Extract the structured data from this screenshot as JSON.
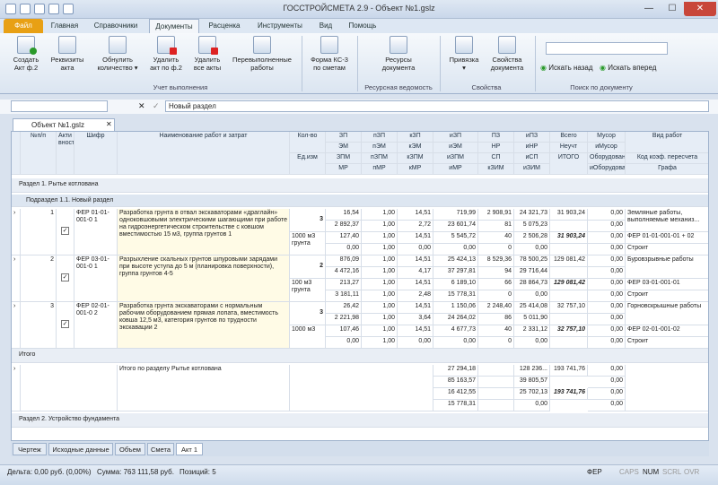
{
  "window": {
    "title": "ГОССТРОЙСМЕТА 2.9 - Объект №1.gslz",
    "minimize": "—",
    "maximize": "☐",
    "close": "✕"
  },
  "menu": {
    "file": "Файл",
    "tabs": [
      "Главная",
      "Справочники",
      "Документы",
      "Расценка",
      "Инструменты",
      "Вид",
      "Помощь"
    ]
  },
  "ribbon": {
    "buttons": [
      {
        "label": "Создать\nАкт ф.2",
        "icon": "new-act-icon"
      },
      {
        "label": "Реквизиты\nакта",
        "icon": "act-props-icon"
      },
      {
        "label": "Обнулить\nколичество ▾",
        "icon": "reset-qty-icon"
      },
      {
        "label": "Удалить\nакт по ф.2",
        "icon": "delete-act-icon"
      },
      {
        "label": "Удалить\nвсе акты",
        "icon": "delete-all-icon"
      },
      {
        "label": "Перевыполненные\nработы",
        "icon": "overdone-icon"
      },
      {
        "label": "Форма КС-3\nпо сметам",
        "icon": "ks3-icon"
      },
      {
        "label": "Ресурсы\nдокумента",
        "icon": "resources-icon"
      },
      {
        "label": "Привязка\n▾",
        "icon": "binding-icon"
      },
      {
        "label": "Свойства\nдокумента",
        "icon": "doc-props-icon"
      }
    ],
    "groups": [
      "Учет выполнения",
      "Ресурсная ведомость",
      "Свойства",
      "Поиск по документу"
    ],
    "search_back": "Искать назад",
    "search_fwd": "Искать вперед"
  },
  "formula": {
    "value": "Новый раздел",
    "cancel": "✕",
    "ok": "✓"
  },
  "doc_tab": "Объект №1.gslz",
  "header": {
    "num": "№п/п",
    "active": "Акти вность",
    "code": "Шифр",
    "name": "Наименование работ и затрат",
    "qty": "Кол-во",
    "unit": "Ед.изм",
    "cols": [
      [
        "ЗП",
        "ЭМ",
        "ЗПМ",
        "МР"
      ],
      [
        "пЗП",
        "пЭМ",
        "пЗПМ",
        "пМР"
      ],
      [
        "кЗП",
        "кЭМ",
        "кЗПМ",
        "кМР"
      ],
      [
        "иЗП",
        "иЭМ",
        "иЗПМ",
        "иМР"
      ],
      [
        "ПЗ",
        "НР",
        "СП",
        "кЗИМ"
      ],
      [
        "иПЗ",
        "иНР",
        "иСП",
        "иЗИМ"
      ]
    ],
    "total1": "Всего",
    "total2": "Неучт",
    "itogo": "ИТОГО",
    "trash": [
      "Мусор",
      "иМусор",
      "Оборудование",
      "иОборудование"
    ],
    "work": [
      "Вид работ",
      "Код коэф. пересчета",
      "Графа"
    ]
  },
  "section1": "Раздел 1. Рытье котлована",
  "subsection": "Подраздел 1.1. Новый раздел",
  "rows": [
    {
      "num": "1",
      "code": "ФЕР 01-01-001-0 1",
      "name": "Разработка грунта в отвал экскаваторами «драглайн» одноковшовыми электрическими шагающими при работе на гидроэнергетическом строительстве с ковшом вместимостью 15 м3, группа грунтов 1",
      "qty": "3",
      "unit": "1000 м3 грунта",
      "lines": [
        [
          "16,54",
          "1,00",
          "14,51",
          "719,99",
          "2 908,91",
          "24 321,73"
        ],
        [
          "2 892,37",
          "1,00",
          "2,72",
          "23 601,74",
          "81",
          "5 075,23"
        ],
        [
          "127,40",
          "1,00",
          "14,51",
          "5 545,72",
          "40",
          "2 506,28"
        ],
        [
          "0,00",
          "1,00",
          "0,00",
          "0,00",
          "0",
          "0,00"
        ]
      ],
      "total": "31 903,24",
      "itogo": "31 903,24",
      "trash": [
        "0,00",
        "0,00",
        "0,00",
        "0,00"
      ],
      "work": [
        "Земляные работы, выполняемые механиз...",
        "ФЕР 01-01-001-01 + 02",
        "Строит"
      ]
    },
    {
      "num": "2",
      "code": "ФЕР 03-01-001-0 1",
      "name": "Разрыхление скальных грунтов шпуровыми зарядами при высоте уступа до 5 м (планировка поверхности), группа грунтов 4-5",
      "qty": "2",
      "unit": "100 м3 грунта",
      "lines": [
        [
          "876,09",
          "1,00",
          "14,51",
          "25 424,13",
          "8 529,36",
          "78 500,25"
        ],
        [
          "4 472,16",
          "1,00",
          "4,17",
          "37 297,81",
          "94",
          "29 716,44"
        ],
        [
          "213,27",
          "1,00",
          "14,51",
          "6 189,10",
          "66",
          "28 864,73"
        ],
        [
          "3 181,11",
          "1,00",
          "2,48",
          "15 778,31",
          "0",
          "0,00"
        ]
      ],
      "total": "129 081,42",
      "itogo": "129 081,42",
      "trash": [
        "0,00",
        "0,00",
        "0,00",
        "0,00"
      ],
      "work": [
        "Буровзрывные работы",
        "ФЕР 03-01-001-01",
        "Строит"
      ]
    },
    {
      "num": "3",
      "code": "ФЕР 02-01-001-0 2",
      "name": "Разработка грунта экскаваторами с нормальным рабочим оборудованием прямая лопата, вместимость ковша 12,5 м3, категория грунтов по трудности экскавации 2",
      "qty": "3",
      "unit": "1000 м3",
      "lines": [
        [
          "26,42",
          "1,00",
          "14,51",
          "1 150,06",
          "2 248,40",
          "25 414,08"
        ],
        [
          "2 221,98",
          "1,00",
          "3,64",
          "24 264,02",
          "86",
          "5 011,90"
        ],
        [
          "107,46",
          "1,00",
          "14,51",
          "4 677,73",
          "40",
          "2 331,12"
        ],
        [
          "0,00",
          "1,00",
          "0,00",
          "0,00",
          "0",
          "0,00"
        ]
      ],
      "total": "32 757,10",
      "itogo": "32 757,10",
      "trash": [
        "0,00",
        "0,00",
        "0,00",
        "0,00"
      ],
      "work": [
        "Горновскрышные работы",
        "ФЕР 02-01-001-02",
        "Строит"
      ]
    }
  ],
  "itogo_label": "Итого",
  "itogo_row": {
    "name": "Итого по разделу Рытье котлована",
    "lines": [
      [
        "27 294,18",
        "128 236..."
      ],
      [
        "85 163,57",
        "39 805,57"
      ],
      [
        "16 412,55",
        "25 702,13"
      ],
      [
        "15 778,31",
        "0,00"
      ]
    ],
    "total": "193 741,76",
    "itogo": "193 741,76",
    "trash": [
      "0,00",
      "0,00",
      "0,00",
      "0,00"
    ]
  },
  "section2": "Раздел 2. Устройство фундамента",
  "bottom_tabs": [
    "Чертеж",
    "Исходные данные",
    "Объем",
    "Смета",
    "Акт 1"
  ],
  "status": {
    "delta": "Дельта: 0,00 руб. (0,00%)",
    "sum": "Сумма: 763 111,58 руб.",
    "positions": "Позиций: 5",
    "fer": "ФЕР",
    "caps": "CAPS",
    "num": "NUM",
    "scrl": "SCRL",
    "ovr": "OVR"
  }
}
